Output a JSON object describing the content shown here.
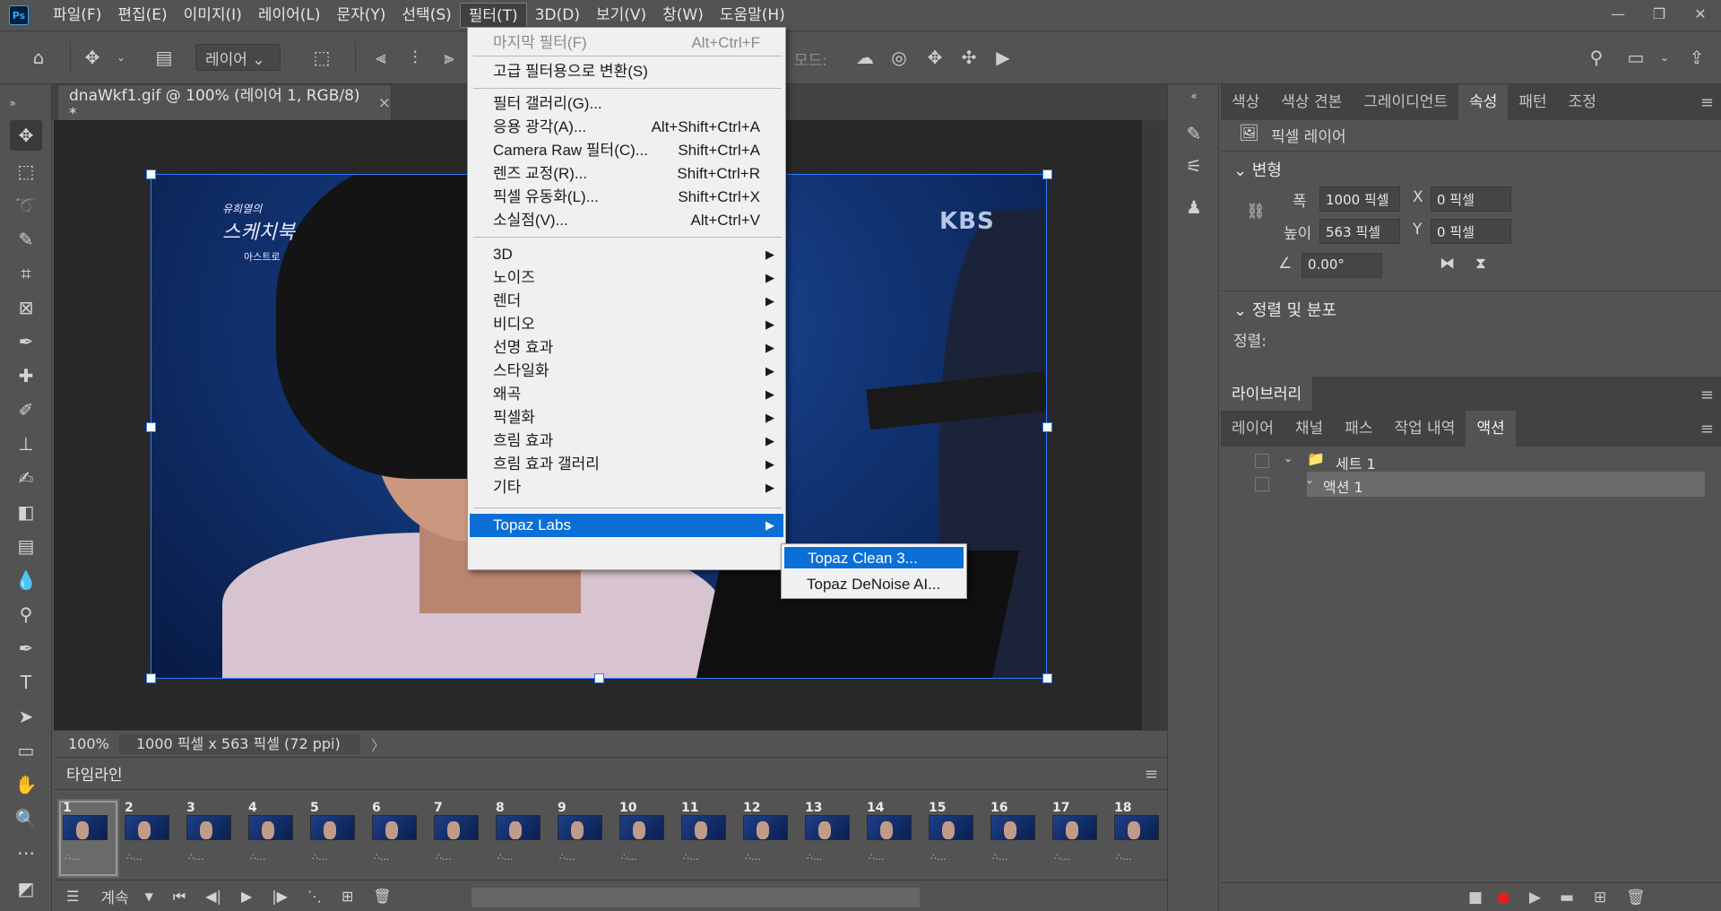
{
  "app": {
    "logo": "Ps",
    "window_controls": [
      "—",
      "❐",
      "✕"
    ]
  },
  "menubar": [
    {
      "label": "파일(F)"
    },
    {
      "label": "편집(E)"
    },
    {
      "label": "이미지(I)"
    },
    {
      "label": "레이어(L)"
    },
    {
      "label": "문자(Y)"
    },
    {
      "label": "선택(S)"
    },
    {
      "label": "필터(T)",
      "active": true
    },
    {
      "label": "3D(D)"
    },
    {
      "label": "보기(V)"
    },
    {
      "label": "창(W)"
    },
    {
      "label": "도움말(H)"
    }
  ],
  "options": {
    "layer_dropdown": "레이어",
    "mode_label": "모드:"
  },
  "document": {
    "tab_title": "dnaWkf1.gif @ 100% (레이어 1, RGB/8) *",
    "tab_close": "×",
    "zoom": "100%",
    "dimensions": "1000 픽셀 x 563 픽셀 (72 ppi)",
    "status_arrow": "〉",
    "image_logo_script": "스케치북",
    "image_logo_top": "유희열의",
    "image_logo_sub": "아스트로",
    "image_broadcaster": "KBS"
  },
  "filter_menu": {
    "items": [
      {
        "label": "마지막 필터(F)",
        "shortcut": "Alt+Ctrl+F",
        "disabled": true
      },
      {
        "sep": true
      },
      {
        "label": "고급 필터용으로 변환(S)"
      },
      {
        "sep": true
      },
      {
        "label": "필터 갤러리(G)..."
      },
      {
        "label": "응용 광각(A)...",
        "shortcut": "Alt+Shift+Ctrl+A"
      },
      {
        "label": "Camera Raw 필터(C)...",
        "shortcut": "Shift+Ctrl+A"
      },
      {
        "label": "렌즈 교정(R)...",
        "shortcut": "Shift+Ctrl+R"
      },
      {
        "label": "픽셀 유동화(L)...",
        "shortcut": "Shift+Ctrl+X"
      },
      {
        "label": "소실점(V)...",
        "shortcut": "Alt+Ctrl+V"
      },
      {
        "sep": true
      },
      {
        "label": "3D",
        "submenu": true
      },
      {
        "label": "노이즈",
        "submenu": true
      },
      {
        "label": "렌더",
        "submenu": true
      },
      {
        "label": "비디오",
        "submenu": true
      },
      {
        "label": "선명 효과",
        "submenu": true
      },
      {
        "label": "스타일화",
        "submenu": true
      },
      {
        "label": "왜곡",
        "submenu": true
      },
      {
        "label": "픽셀화",
        "submenu": true
      },
      {
        "label": "흐림 효과",
        "submenu": true
      },
      {
        "label": "흐림 효과 갤러리",
        "submenu": true
      },
      {
        "label": "기타",
        "submenu": true
      },
      {
        "sep": true
      },
      {
        "label": "Topaz Labs",
        "submenu": true,
        "highlighted": true
      }
    ]
  },
  "topaz_submenu": [
    {
      "label": "Topaz Clean 3...",
      "highlighted": true
    },
    {
      "label": "Topaz DeNoise AI..."
    }
  ],
  "timeline": {
    "title": "타임라인",
    "loop": "계속",
    "frames": [
      "1",
      "2",
      "3",
      "4",
      "5",
      "6",
      "7",
      "8",
      "9",
      "10",
      "11",
      "12",
      "13",
      "14",
      "15",
      "16",
      "17",
      "18"
    ],
    "frame_sub": "∴..."
  },
  "properties": {
    "tabs": [
      "색상",
      "색상 견본",
      "그레이디언트",
      "속성",
      "패턴",
      "조정"
    ],
    "active_tab": "속성",
    "layer_type": "픽셀 레이어",
    "transform_title": "변형",
    "width_label": "폭",
    "width_value": "1000 픽셀",
    "height_label": "높이",
    "height_value": "563 픽셀",
    "x_label": "X",
    "x_value": "0 픽셀",
    "y_label": "Y",
    "y_value": "0 픽셀",
    "angle_value": "0.00°",
    "align_title": "정렬 및 분포",
    "align_label": "정렬:"
  },
  "library": {
    "title": "라이브러리"
  },
  "actions_panel": {
    "tabs": [
      "레이어",
      "채널",
      "패스",
      "작업 내역",
      "액션"
    ],
    "active_tab": "액션",
    "set_name": "세트 1",
    "action_name": "액션 1"
  }
}
